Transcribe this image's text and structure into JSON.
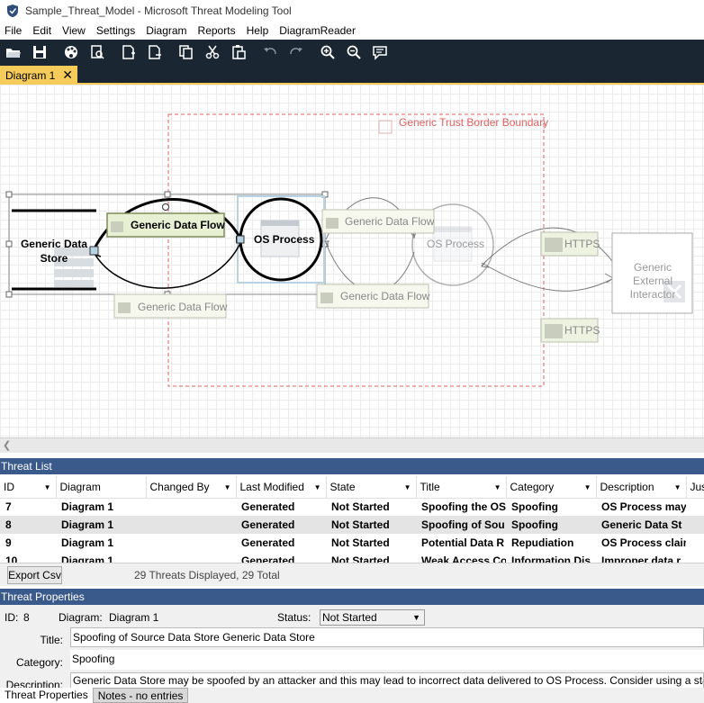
{
  "window": {
    "title": "Sample_Threat_Model - Microsoft Threat Modeling Tool"
  },
  "menu": [
    "File",
    "Edit",
    "View",
    "Settings",
    "Diagram",
    "Reports",
    "Help",
    "DiagramReader"
  ],
  "tab": {
    "label": "Diagram 1",
    "close": "✕"
  },
  "diagram": {
    "trust_boundary": "Generic Trust Border Boundary",
    "data_store": "Generic Data Store",
    "process_selected": "OS Process",
    "process_faded": "OS Process",
    "flow_selected": "Generic Data Flow",
    "flow_lower": "Generic Data Flow",
    "flow_right_top": "Generic Data Flow",
    "flow_right_bottom": "Generic Data Flow",
    "https_top": "HTTPS",
    "https_bottom": "HTTPS",
    "external_interactor": "Generic External Interactor"
  },
  "threat_list": {
    "header": "Threat List",
    "columns": [
      "ID",
      "Diagram",
      "Changed By",
      "Last Modified",
      "State",
      "Title",
      "Category",
      "Description",
      "Jus"
    ],
    "rows": [
      {
        "id": "7",
        "diagram": "Diagram 1",
        "changed_by": "",
        "last_modified": "Generated",
        "state": "Not Started",
        "title": "Spoofing the OS",
        "category": "Spoofing",
        "description": "OS Process may"
      },
      {
        "id": "8",
        "diagram": "Diagram 1",
        "changed_by": "",
        "last_modified": "Generated",
        "state": "Not Started",
        "title": "Spoofing of Sou",
        "category": "Spoofing",
        "description": "Generic Data St"
      },
      {
        "id": "9",
        "diagram": "Diagram 1",
        "changed_by": "",
        "last_modified": "Generated",
        "state": "Not Started",
        "title": "Potential Data R",
        "category": "Repudiation",
        "description": "OS Process clain"
      },
      {
        "id": "10",
        "diagram": "Diagram 1",
        "changed_by": "",
        "last_modified": "Generated",
        "state": "Not Started",
        "title": "Weak Access Co",
        "category": "Information Dis",
        "description": "Improper data r"
      }
    ],
    "selected_index": 1,
    "export_label": "Export Csv",
    "status": "29 Threats Displayed, 29 Total"
  },
  "threat_properties": {
    "header": "Threat Properties",
    "id_label": "ID:",
    "id_value": "8",
    "diagram_label": "Diagram:",
    "diagram_value": "Diagram 1",
    "status_label": "Status:",
    "status_value": "Not Started",
    "title_label": "Title:",
    "title_value": "Spoofing of Source Data Store Generic Data Store",
    "category_label": "Category:",
    "category_value": "Spoofing",
    "description_label": "Description:",
    "description_value": "Generic Data Store may be spoofed by an attacker and this may lead to incorrect data delivered to OS Process. Consider using a standard"
  },
  "bottom_tabs": [
    "Threat Properties",
    "Notes - no entries"
  ],
  "colors": {
    "toolbar_bg": "#1b2633",
    "tab_active": "#f5cc5a",
    "panel_header": "#3a5a8c",
    "trust_boundary": "#e06060"
  }
}
